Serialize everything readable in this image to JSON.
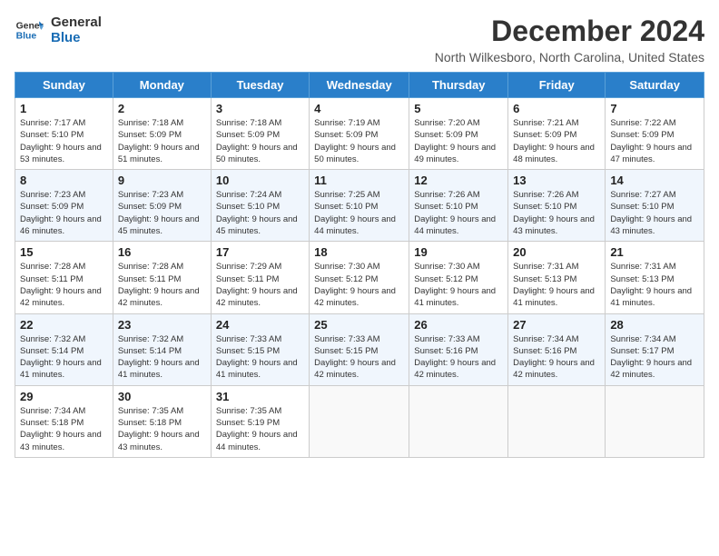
{
  "logo": {
    "line1": "General",
    "line2": "Blue"
  },
  "title": "December 2024",
  "location": "North Wilkesboro, North Carolina, United States",
  "days_of_week": [
    "Sunday",
    "Monday",
    "Tuesday",
    "Wednesday",
    "Thursday",
    "Friday",
    "Saturday"
  ],
  "weeks": [
    [
      {
        "day": 1,
        "sunrise": "7:17 AM",
        "sunset": "5:10 PM",
        "daylight": "9 hours and 53 minutes."
      },
      {
        "day": 2,
        "sunrise": "7:18 AM",
        "sunset": "5:09 PM",
        "daylight": "9 hours and 51 minutes."
      },
      {
        "day": 3,
        "sunrise": "7:18 AM",
        "sunset": "5:09 PM",
        "daylight": "9 hours and 50 minutes."
      },
      {
        "day": 4,
        "sunrise": "7:19 AM",
        "sunset": "5:09 PM",
        "daylight": "9 hours and 50 minutes."
      },
      {
        "day": 5,
        "sunrise": "7:20 AM",
        "sunset": "5:09 PM",
        "daylight": "9 hours and 49 minutes."
      },
      {
        "day": 6,
        "sunrise": "7:21 AM",
        "sunset": "5:09 PM",
        "daylight": "9 hours and 48 minutes."
      },
      {
        "day": 7,
        "sunrise": "7:22 AM",
        "sunset": "5:09 PM",
        "daylight": "9 hours and 47 minutes."
      }
    ],
    [
      {
        "day": 8,
        "sunrise": "7:23 AM",
        "sunset": "5:09 PM",
        "daylight": "9 hours and 46 minutes."
      },
      {
        "day": 9,
        "sunrise": "7:23 AM",
        "sunset": "5:09 PM",
        "daylight": "9 hours and 45 minutes."
      },
      {
        "day": 10,
        "sunrise": "7:24 AM",
        "sunset": "5:10 PM",
        "daylight": "9 hours and 45 minutes."
      },
      {
        "day": 11,
        "sunrise": "7:25 AM",
        "sunset": "5:10 PM",
        "daylight": "9 hours and 44 minutes."
      },
      {
        "day": 12,
        "sunrise": "7:26 AM",
        "sunset": "5:10 PM",
        "daylight": "9 hours and 44 minutes."
      },
      {
        "day": 13,
        "sunrise": "7:26 AM",
        "sunset": "5:10 PM",
        "daylight": "9 hours and 43 minutes."
      },
      {
        "day": 14,
        "sunrise": "7:27 AM",
        "sunset": "5:10 PM",
        "daylight": "9 hours and 43 minutes."
      }
    ],
    [
      {
        "day": 15,
        "sunrise": "7:28 AM",
        "sunset": "5:11 PM",
        "daylight": "9 hours and 42 minutes."
      },
      {
        "day": 16,
        "sunrise": "7:28 AM",
        "sunset": "5:11 PM",
        "daylight": "9 hours and 42 minutes."
      },
      {
        "day": 17,
        "sunrise": "7:29 AM",
        "sunset": "5:11 PM",
        "daylight": "9 hours and 42 minutes."
      },
      {
        "day": 18,
        "sunrise": "7:30 AM",
        "sunset": "5:12 PM",
        "daylight": "9 hours and 42 minutes."
      },
      {
        "day": 19,
        "sunrise": "7:30 AM",
        "sunset": "5:12 PM",
        "daylight": "9 hours and 41 minutes."
      },
      {
        "day": 20,
        "sunrise": "7:31 AM",
        "sunset": "5:13 PM",
        "daylight": "9 hours and 41 minutes."
      },
      {
        "day": 21,
        "sunrise": "7:31 AM",
        "sunset": "5:13 PM",
        "daylight": "9 hours and 41 minutes."
      }
    ],
    [
      {
        "day": 22,
        "sunrise": "7:32 AM",
        "sunset": "5:14 PM",
        "daylight": "9 hours and 41 minutes."
      },
      {
        "day": 23,
        "sunrise": "7:32 AM",
        "sunset": "5:14 PM",
        "daylight": "9 hours and 41 minutes."
      },
      {
        "day": 24,
        "sunrise": "7:33 AM",
        "sunset": "5:15 PM",
        "daylight": "9 hours and 41 minutes."
      },
      {
        "day": 25,
        "sunrise": "7:33 AM",
        "sunset": "5:15 PM",
        "daylight": "9 hours and 42 minutes."
      },
      {
        "day": 26,
        "sunrise": "7:33 AM",
        "sunset": "5:16 PM",
        "daylight": "9 hours and 42 minutes."
      },
      {
        "day": 27,
        "sunrise": "7:34 AM",
        "sunset": "5:16 PM",
        "daylight": "9 hours and 42 minutes."
      },
      {
        "day": 28,
        "sunrise": "7:34 AM",
        "sunset": "5:17 PM",
        "daylight": "9 hours and 42 minutes."
      }
    ],
    [
      {
        "day": 29,
        "sunrise": "7:34 AM",
        "sunset": "5:18 PM",
        "daylight": "9 hours and 43 minutes."
      },
      {
        "day": 30,
        "sunrise": "7:35 AM",
        "sunset": "5:18 PM",
        "daylight": "9 hours and 43 minutes."
      },
      {
        "day": 31,
        "sunrise": "7:35 AM",
        "sunset": "5:19 PM",
        "daylight": "9 hours and 44 minutes."
      },
      null,
      null,
      null,
      null
    ]
  ]
}
